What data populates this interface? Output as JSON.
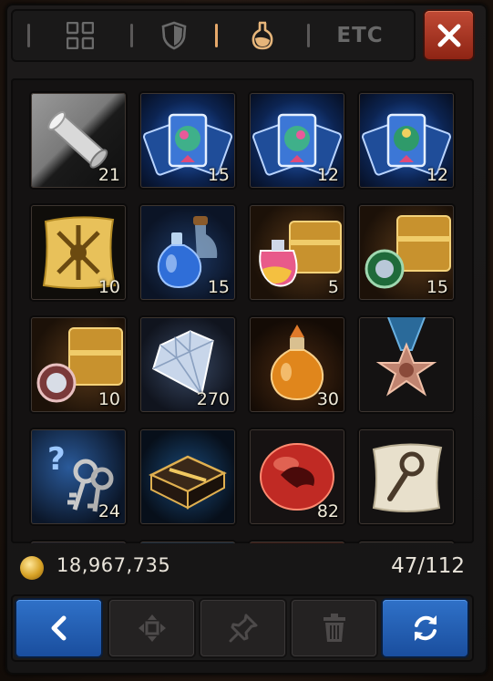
{
  "tabs": [
    {
      "name": "tab-all",
      "icon": "grid-icon",
      "active": false
    },
    {
      "name": "tab-equipment",
      "icon": "shield-icon",
      "active": false
    },
    {
      "name": "tab-consumables",
      "icon": "potion-icon",
      "active": true
    },
    {
      "name": "tab-etc",
      "label": "ETC",
      "active": false
    }
  ],
  "close": {
    "icon": "close-icon"
  },
  "items": [
    {
      "name": "scroll-item",
      "icon": "scroll-icon",
      "qty": "21"
    },
    {
      "name": "card-pack-item-1",
      "icon": "card-pack-icon",
      "qty": "15"
    },
    {
      "name": "card-pack-item-2",
      "icon": "card-pack-icon",
      "qty": "12"
    },
    {
      "name": "card-pack-item-3",
      "icon": "card-pack-icon",
      "qty": "12"
    },
    {
      "name": "map-scroll-item",
      "icon": "golden-scroll-icon",
      "qty": "10"
    },
    {
      "name": "blue-potion-item",
      "icon": "potion-icon",
      "qty": "15"
    },
    {
      "name": "potion-chest-item",
      "icon": "chest-icon",
      "qty": "5"
    },
    {
      "name": "gem-chest-item",
      "icon": "chest-icon",
      "qty": "15"
    },
    {
      "name": "silver-chest-item",
      "icon": "chest-icon",
      "qty": "10"
    },
    {
      "name": "diamond-item",
      "icon": "diamond-icon",
      "qty": "270"
    },
    {
      "name": "orange-potion-item",
      "icon": "potion-icon",
      "qty": "30"
    },
    {
      "name": "medal-item",
      "icon": "medal-icon",
      "qty": ""
    },
    {
      "name": "keys-item",
      "icon": "keys-icon",
      "qty": "24"
    },
    {
      "name": "black-chest-item",
      "icon": "chest-icon",
      "qty": ""
    },
    {
      "name": "dragon-orb-item",
      "icon": "orb-icon",
      "qty": "82"
    },
    {
      "name": "map-item",
      "icon": "map-icon",
      "qty": ""
    }
  ],
  "footer": {
    "gold": "18,967,735",
    "capacity": "47/112"
  },
  "buttons": [
    {
      "name": "back-button",
      "icon": "chevron-left-icon"
    },
    {
      "name": "move-button",
      "icon": "move-icon"
    },
    {
      "name": "pin-button",
      "icon": "pin-icon"
    },
    {
      "name": "delete-button",
      "icon": "trash-icon"
    },
    {
      "name": "sort-button",
      "icon": "refresh-icon"
    }
  ],
  "colors": {
    "accent": "#e6a86a",
    "button_blue": "#2f71c8",
    "close_red": "#b03a26"
  }
}
